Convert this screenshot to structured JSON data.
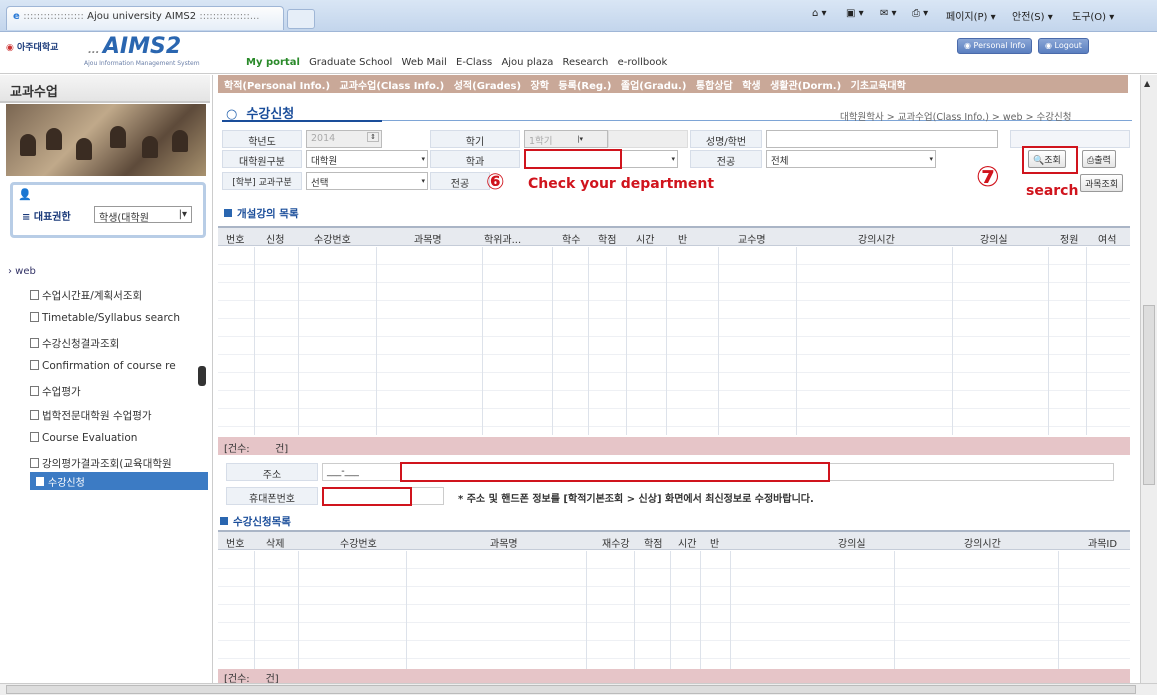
{
  "browser": {
    "tab_title": "Ajou university AIMS2",
    "tab_decor_left": "::::::::::::::::::",
    "tab_decor_right": ":::::::::::::::...",
    "toolbar": [
      "페이지(P)",
      "안전(S)",
      "도구(O)"
    ]
  },
  "header": {
    "logo_ajou": "아주대학교",
    "logo_aims": "AIMS2",
    "logo_sub": "Ajou Information Management System",
    "my_portal": "My portal",
    "nav": [
      "Graduate School",
      "Web Mail",
      "E-Class",
      "Ajou plaza",
      "Research",
      "e-rollbook"
    ],
    "personal_info": "Personal Info",
    "logout": "Logout"
  },
  "menubar": [
    "학적(Personal Info.)",
    "교과수업(Class Info.)",
    "성적(Grades)",
    "장학",
    "등록(Reg.)",
    "졸업(Gradu.)",
    "통합상담",
    "학생",
    "생활관(Dorm.)",
    "기초교육대학"
  ],
  "sidebar": {
    "title": "교과수업",
    "role_label": "대표권한",
    "role_value": "학생(대학원",
    "section": "› web",
    "items": [
      "수업시간표/계획서조회",
      "Timetable/Syllabus search",
      "수강신청결과조회",
      "Confirmation of course re",
      "수업평가",
      "법학전문대학원 수업평가",
      "Course Evaluation",
      "강의평가결과조회(교육대학원"
    ],
    "active_item": "수강신청"
  },
  "content": {
    "title": "수강신청",
    "breadcrumb": "대학원학사 > 교과수업(Class Info.) > web > 수강신청",
    "form": {
      "year_label": "학년도",
      "year_value": "2014",
      "semester_label": "학기",
      "semester_value": "1학기",
      "name_label": "성명/학번",
      "name_value": "",
      "grad_label": "대학원구분",
      "grad_value": "대학원",
      "dept_label": "학과",
      "dept_value": "",
      "major_label": "전공",
      "major_value": "전체",
      "type_label": "[학부] 교과구분",
      "type_value": "선택",
      "major2_label": "전공"
    },
    "buttons": {
      "search": "조회",
      "print": "출력",
      "course_search": "과목조회"
    },
    "annotations": {
      "step6_num": "⑥",
      "step6_text": "Check your department",
      "step7_num": "⑦",
      "step7_text": "search"
    },
    "open_courses": {
      "title": "개설강의 목록",
      "columns": [
        "번호",
        "신청",
        "수강번호",
        "과목명",
        "학위과...",
        "학수",
        "학점",
        "시간",
        "반",
        "교수명",
        "강의시간",
        "강의실",
        "정원",
        "여석"
      ],
      "count_label": "[건수:",
      "count_unit": "건]"
    },
    "address_label": "주소",
    "address_value": "___-___",
    "phone_label": "휴대폰번호",
    "phone_value": "",
    "notice": "* 주소 및 핸드폰 정보를 [학적기본조회 > 신상] 화면에서 최신정보로 수정바랍니다.",
    "registered": {
      "title": "수강신청목록",
      "columns": [
        "번호",
        "삭제",
        "수강번호",
        "과목명",
        "재수강",
        "학점",
        "시간",
        "반",
        "강의실",
        "강의시간",
        "과목ID"
      ],
      "count_label": "[건수:",
      "count_unit": "건]"
    }
  }
}
